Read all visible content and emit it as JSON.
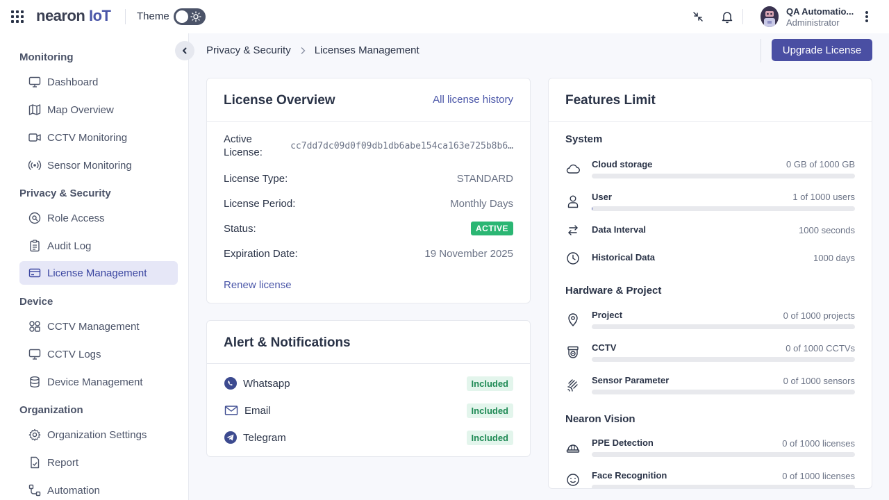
{
  "app": {
    "logo_main": "nearon",
    "logo_suffix": "IoT",
    "theme_label": "Theme"
  },
  "topbar": {
    "user_name": "QA Automatio...",
    "user_role": "Administrator",
    "icons": [
      "fullscreen-exit-icon",
      "bell-icon",
      "kebab-menu-icon"
    ]
  },
  "sidebar": {
    "sections": [
      {
        "title": "Monitoring",
        "items": [
          {
            "label": "Dashboard",
            "icon": "monitor-icon"
          },
          {
            "label": "Map Overview",
            "icon": "map-icon"
          },
          {
            "label": "CCTV Monitoring",
            "icon": "video-icon"
          },
          {
            "label": "Sensor Monitoring",
            "icon": "broadcast-icon"
          }
        ]
      },
      {
        "title": "Privacy & Security",
        "items": [
          {
            "label": "Role Access",
            "icon": "user-search-icon"
          },
          {
            "label": "Audit Log",
            "icon": "clipboard-icon"
          },
          {
            "label": "License Management",
            "icon": "card-icon",
            "active": true
          }
        ]
      },
      {
        "title": "Device",
        "items": [
          {
            "label": "CCTV Management",
            "icon": "grid-circles-icon"
          },
          {
            "label": "CCTV Logs",
            "icon": "monitor-icon"
          },
          {
            "label": "Device Management",
            "icon": "database-icon"
          }
        ]
      },
      {
        "title": "Organization",
        "items": [
          {
            "label": "Organization Settings",
            "icon": "gear-icon"
          },
          {
            "label": "Report",
            "icon": "report-icon"
          },
          {
            "label": "Automation",
            "icon": "flow-icon"
          }
        ]
      }
    ]
  },
  "breadcrumb": {
    "parent": "Privacy & Security",
    "current": "Licenses Management"
  },
  "header": {
    "upgrade_label": "Upgrade License"
  },
  "license_overview": {
    "title": "License Overview",
    "history_link": "All license history",
    "active_license_key": "Active",
    "active_license_key2": "License:",
    "active_license_value": "cc7dd7dc09d0f09db1db6abe154ca163e725b8b6…",
    "type_key": "License Type:",
    "type_value": "STANDARD",
    "period_key": "License Period:",
    "period_value": "Monthly Days",
    "status_key": "Status:",
    "status_value": "ACTIVE",
    "expiration_key": "Expiration Date:",
    "expiration_value": "19 November 2025",
    "renew_link": "Renew license"
  },
  "alerts": {
    "title": "Alert & Notifications",
    "items": [
      {
        "label": "Whatsapp",
        "badge": "Included",
        "icon": "whatsapp-icon"
      },
      {
        "label": "Email",
        "badge": "Included",
        "icon": "mail-icon"
      },
      {
        "label": "Telegram",
        "badge": "Included",
        "icon": "telegram-icon"
      }
    ]
  },
  "features": {
    "title": "Features Limit",
    "system_title": "System",
    "hardware_title": "Hardware & Project",
    "vision_title": "Nearon Vision",
    "items": [
      {
        "name": "Cloud storage",
        "value": "0 GB of 1000 GB",
        "progress": 0,
        "icon": "cloud-icon"
      },
      {
        "name": "User",
        "value": "1 of 1000 users",
        "progress": 0.001,
        "icon": "user-icon"
      },
      {
        "name": "Data Interval",
        "value": "1000 seconds",
        "icon": "swap-icon"
      },
      {
        "name": "Historical Data",
        "value": "1000 days",
        "icon": "clock-icon"
      },
      {
        "name": "Project",
        "value": "0 of 1000 projects",
        "progress": 0,
        "icon": "location-pin-icon"
      },
      {
        "name": "CCTV",
        "value": "0 of 1000 CCTVs",
        "progress": 0,
        "icon": "camera-icon"
      },
      {
        "name": "Sensor Parameter",
        "value": "0 of 1000 sensors",
        "progress": 0,
        "icon": "sensor-waves-icon"
      },
      {
        "name": "PPE Detection",
        "value": "0 of 1000 licenses",
        "progress": 0,
        "icon": "helmet-icon"
      },
      {
        "name": "Face Recognition",
        "value": "0 of 1000 licenses",
        "progress": 0,
        "icon": "face-icon"
      }
    ]
  },
  "colors": {
    "accent": "#4a4fa3",
    "active_badge": "#2bb673",
    "included_bg": "#e3f5ec",
    "sidebar_active_bg": "#e6e7f7"
  }
}
